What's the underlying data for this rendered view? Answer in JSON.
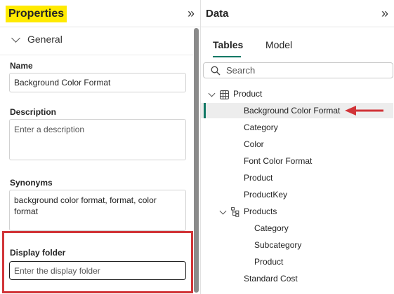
{
  "properties": {
    "title": "Properties",
    "expand_icon": "»",
    "section": "General",
    "name_label": "Name",
    "name_value": "Background Color Format",
    "description_label": "Description",
    "description_placeholder": "Enter a description",
    "synonyms_label": "Synonyms",
    "synonyms_value": "background color format, format, color format",
    "display_folder_label": "Display folder",
    "display_folder_placeholder": "Enter the display folder",
    "highlight_color": "#ffea00",
    "callout_color": "#d13438"
  },
  "data_pane": {
    "title": "Data",
    "expand_icon": "»",
    "tabs": [
      "Tables",
      "Model"
    ],
    "active_tab": "Tables",
    "search_placeholder": "Search",
    "accent_color": "#117865",
    "tree": [
      {
        "label": "Product",
        "type": "table",
        "expanded": true
      },
      {
        "label": "Background Color Format",
        "type": "column",
        "selected": true
      },
      {
        "label": "Category",
        "type": "column"
      },
      {
        "label": "Color",
        "type": "column"
      },
      {
        "label": "Font Color Format",
        "type": "column"
      },
      {
        "label": "Product",
        "type": "column"
      },
      {
        "label": "ProductKey",
        "type": "column"
      },
      {
        "label": "Products",
        "type": "hierarchy",
        "expanded": true
      },
      {
        "label": "Category",
        "type": "level"
      },
      {
        "label": "Subcategory",
        "type": "level"
      },
      {
        "label": "Product",
        "type": "level"
      },
      {
        "label": "Standard Cost",
        "type": "column"
      }
    ]
  }
}
